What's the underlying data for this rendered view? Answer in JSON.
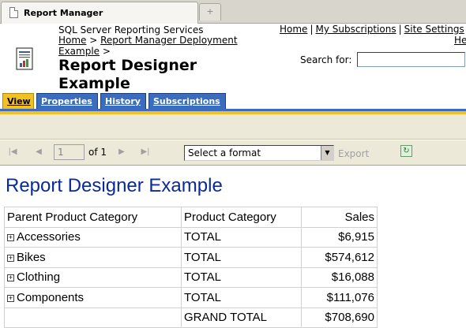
{
  "browser": {
    "tab_title": "Report Manager",
    "new_tab_symbol": "+"
  },
  "header": {
    "product_name": "SQL Server Reporting Services",
    "breadcrumb": {
      "home": "Home",
      "sep1": " > ",
      "folder": "Report Manager Deployment Example",
      "sep2": " >"
    },
    "page_title": "Report Designer Example",
    "toplinks": {
      "home": "Home",
      "subscriptions": "My Subscriptions",
      "site_settings": "Site Settings",
      "help": "He"
    },
    "search": {
      "label": "Search for:",
      "value": ""
    }
  },
  "tabs": [
    {
      "label": "View",
      "active": true
    },
    {
      "label": "Properties"
    },
    {
      "label": "History"
    },
    {
      "label": "Subscriptions"
    }
  ],
  "toolbar": {
    "first_icon": "first-page-icon",
    "prev_icon": "previous-page-icon",
    "page_value": "1",
    "of_label": "of 1",
    "next_icon": "next-page-icon",
    "last_icon": "last-page-icon",
    "format_select": "Select a format",
    "export_label": "Export",
    "refresh_icon": "refresh-icon"
  },
  "report": {
    "title": "Report Designer Example",
    "columns": [
      "Parent Product Category",
      "Product Category",
      "Sales"
    ],
    "rows": [
      {
        "parent": "Accessories",
        "category": "TOTAL",
        "sales": "$6,915"
      },
      {
        "parent": "Bikes",
        "category": "TOTAL",
        "sales": "$574,612"
      },
      {
        "parent": "Clothing",
        "category": "TOTAL",
        "sales": "$16,088"
      },
      {
        "parent": "Components",
        "category": "TOTAL",
        "sales": "$111,076"
      }
    ],
    "grand_total": {
      "label": "GRAND TOTAL",
      "sales": "$708,690"
    }
  },
  "colors": {
    "tab_blue": "#3a6cbf",
    "tab_active": "#f2c020",
    "report_title": "#0a2a9a",
    "toolbar_bg": "#ece9d8"
  }
}
